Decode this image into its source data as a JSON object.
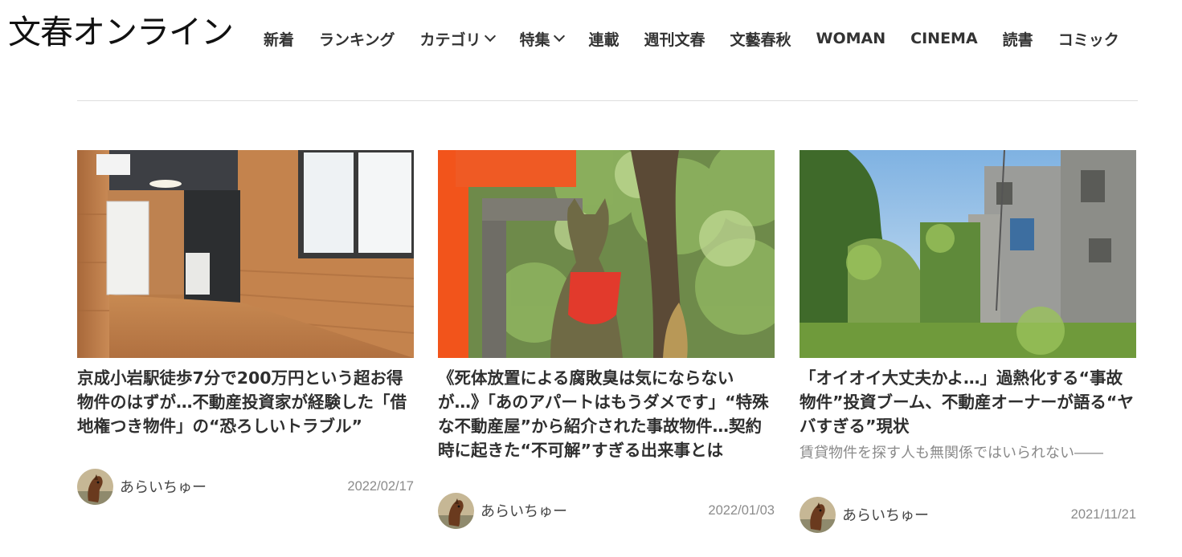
{
  "site": {
    "logo": "文春オンライン"
  },
  "nav": {
    "items": [
      {
        "label": "新着"
      },
      {
        "label": "ランキング"
      },
      {
        "label": "カテゴリ",
        "dropdown": true
      },
      {
        "label": "特集",
        "dropdown": true
      },
      {
        "label": "連載"
      },
      {
        "label": "週刊文春"
      },
      {
        "label": "文藝春秋"
      },
      {
        "label": "WOMAN"
      },
      {
        "label": "CINEMA"
      },
      {
        "label": "読書"
      },
      {
        "label": "コミック"
      }
    ]
  },
  "articles": [
    {
      "title": "京成小岩駅徒歩7分で200万円という超お得物件のはずが…不動産投資家が経験した「借地権つき物件」の“恐ろしいトラブル”",
      "description": "",
      "author": "あらいちゅー",
      "date": "2022/02/17",
      "image": "wooden-apartment-room-photo"
    },
    {
      "title": "《死体放置による腐敗臭は気にならないが…》「あのアパートはもうダメです」“特殊な不動産屋”から紹介された事故物件…契約時に起きた“不可解”すぎる出来事とは",
      "description": "",
      "author": "あらいちゅー",
      "date": "2022/01/03",
      "image": "fox-statue-shrine-photo"
    },
    {
      "title": "「オイオイ大丈夫かよ…」過熱化する“事故物件”投資ブーム、不動産オーナーが語る“ヤバすぎる”現状",
      "description": "賃貸物件を探す人も無関係ではいられない――",
      "author": "あらいちゅー",
      "date": "2021/11/21",
      "image": "overgrown-old-buildings-photo"
    }
  ]
}
